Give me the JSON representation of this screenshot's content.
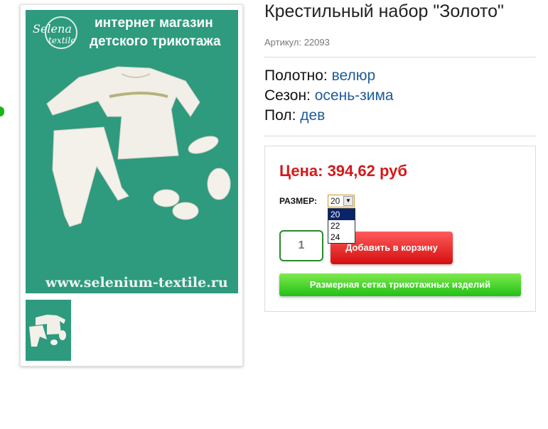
{
  "product": {
    "title": "Крестильный набор \"Золото\"",
    "sku_label": "Артикул:",
    "sku_value": "22093",
    "attributes": [
      {
        "label": "Полотно:",
        "value": "велюр"
      },
      {
        "label": "Сезон:",
        "value": "осень-зима"
      },
      {
        "label": "Пол:",
        "value": "дев"
      }
    ]
  },
  "image": {
    "banner_line1": "интернет магазин",
    "banner_line2": "детского трикотажа",
    "logo_top": "Selena",
    "logo_bottom": "textile",
    "url_text": "www.selenium-textile.ru"
  },
  "purchase": {
    "price_label": "Цена:",
    "price_value": "394,62 руб",
    "size_label": "РАЗМЕР:",
    "size_selected": "20",
    "size_options": [
      "20",
      "22",
      "24"
    ],
    "quantity": "1",
    "add_to_cart_label": "Добавить в корзину",
    "size_chart_label": "Размерная сетка трикотажных изделий"
  },
  "colors": {
    "price": "#d41a1a",
    "attribute_value": "#1f5b9a",
    "image_background": "#2e9a7e",
    "add_button": "#e41e1e",
    "size_chart_button": "#3fd12a"
  }
}
